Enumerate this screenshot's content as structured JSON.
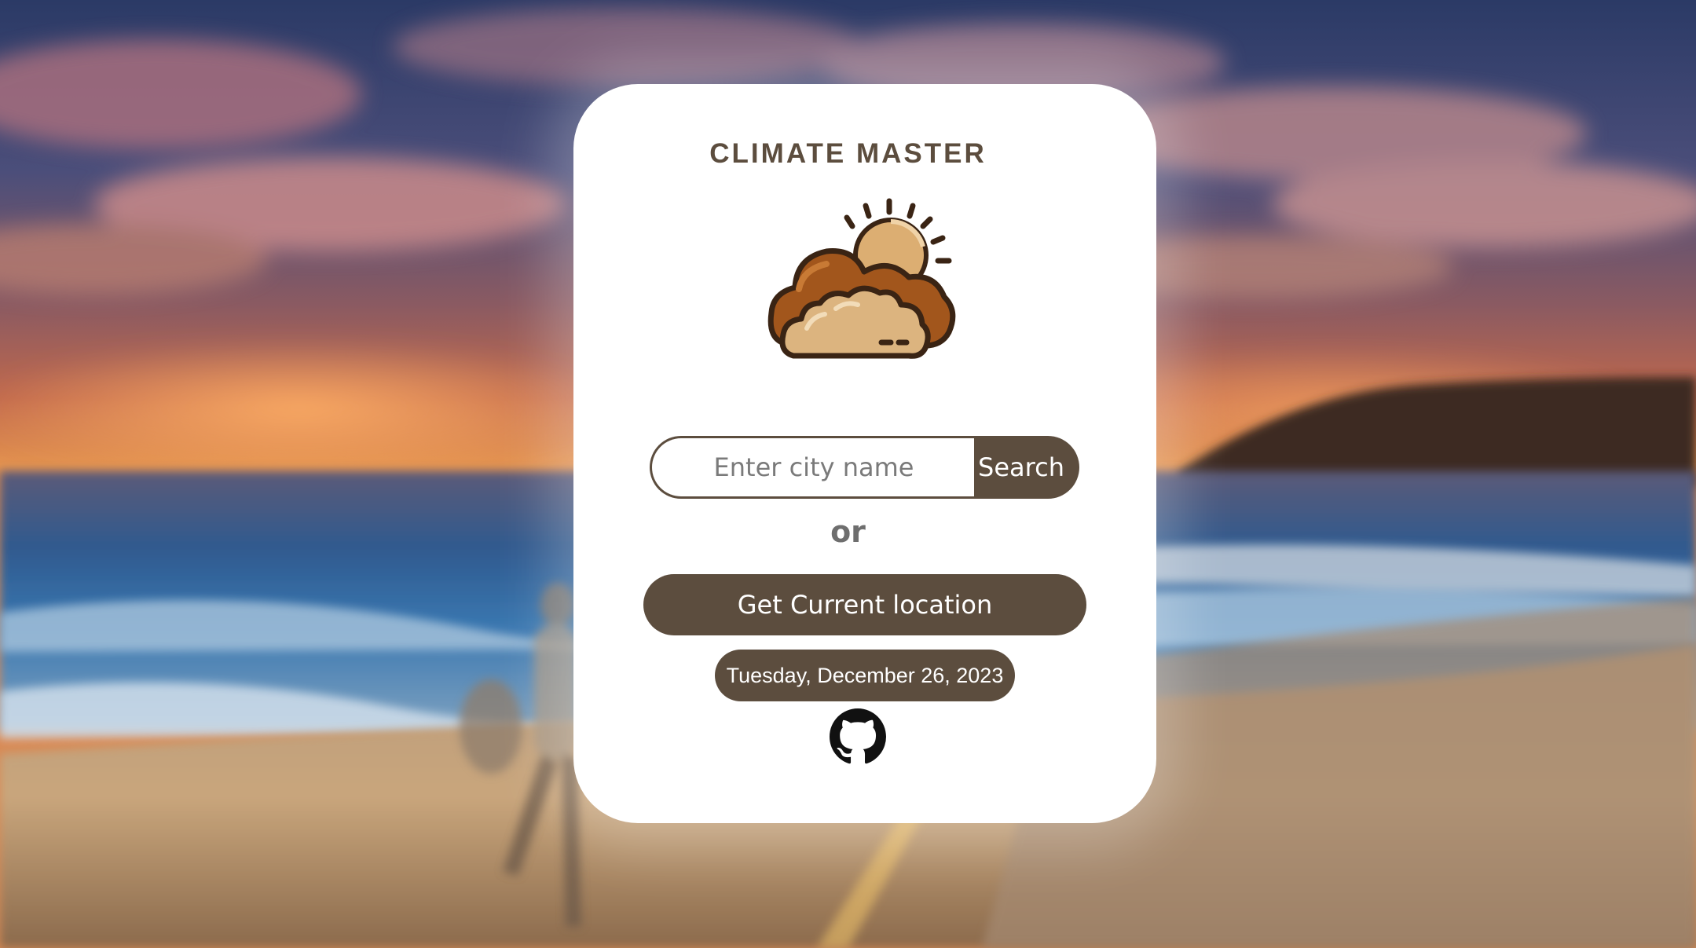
{
  "app": {
    "title": "CLIMATE MASTER"
  },
  "logo": {
    "icon": "sun-behind-clouds-icon"
  },
  "search": {
    "placeholder": "Enter city name",
    "value": "",
    "button_label": "Search"
  },
  "divider_text": "or",
  "location": {
    "button_label": "Get Current location"
  },
  "date": {
    "text": "Tuesday, December 26, 2023"
  },
  "footer": {
    "github_icon": "github-icon"
  },
  "colors": {
    "accent": "#5c4d3e",
    "card": "#ffffff",
    "title": "#5c4d3e",
    "muted_text": "#6e6e6e"
  }
}
